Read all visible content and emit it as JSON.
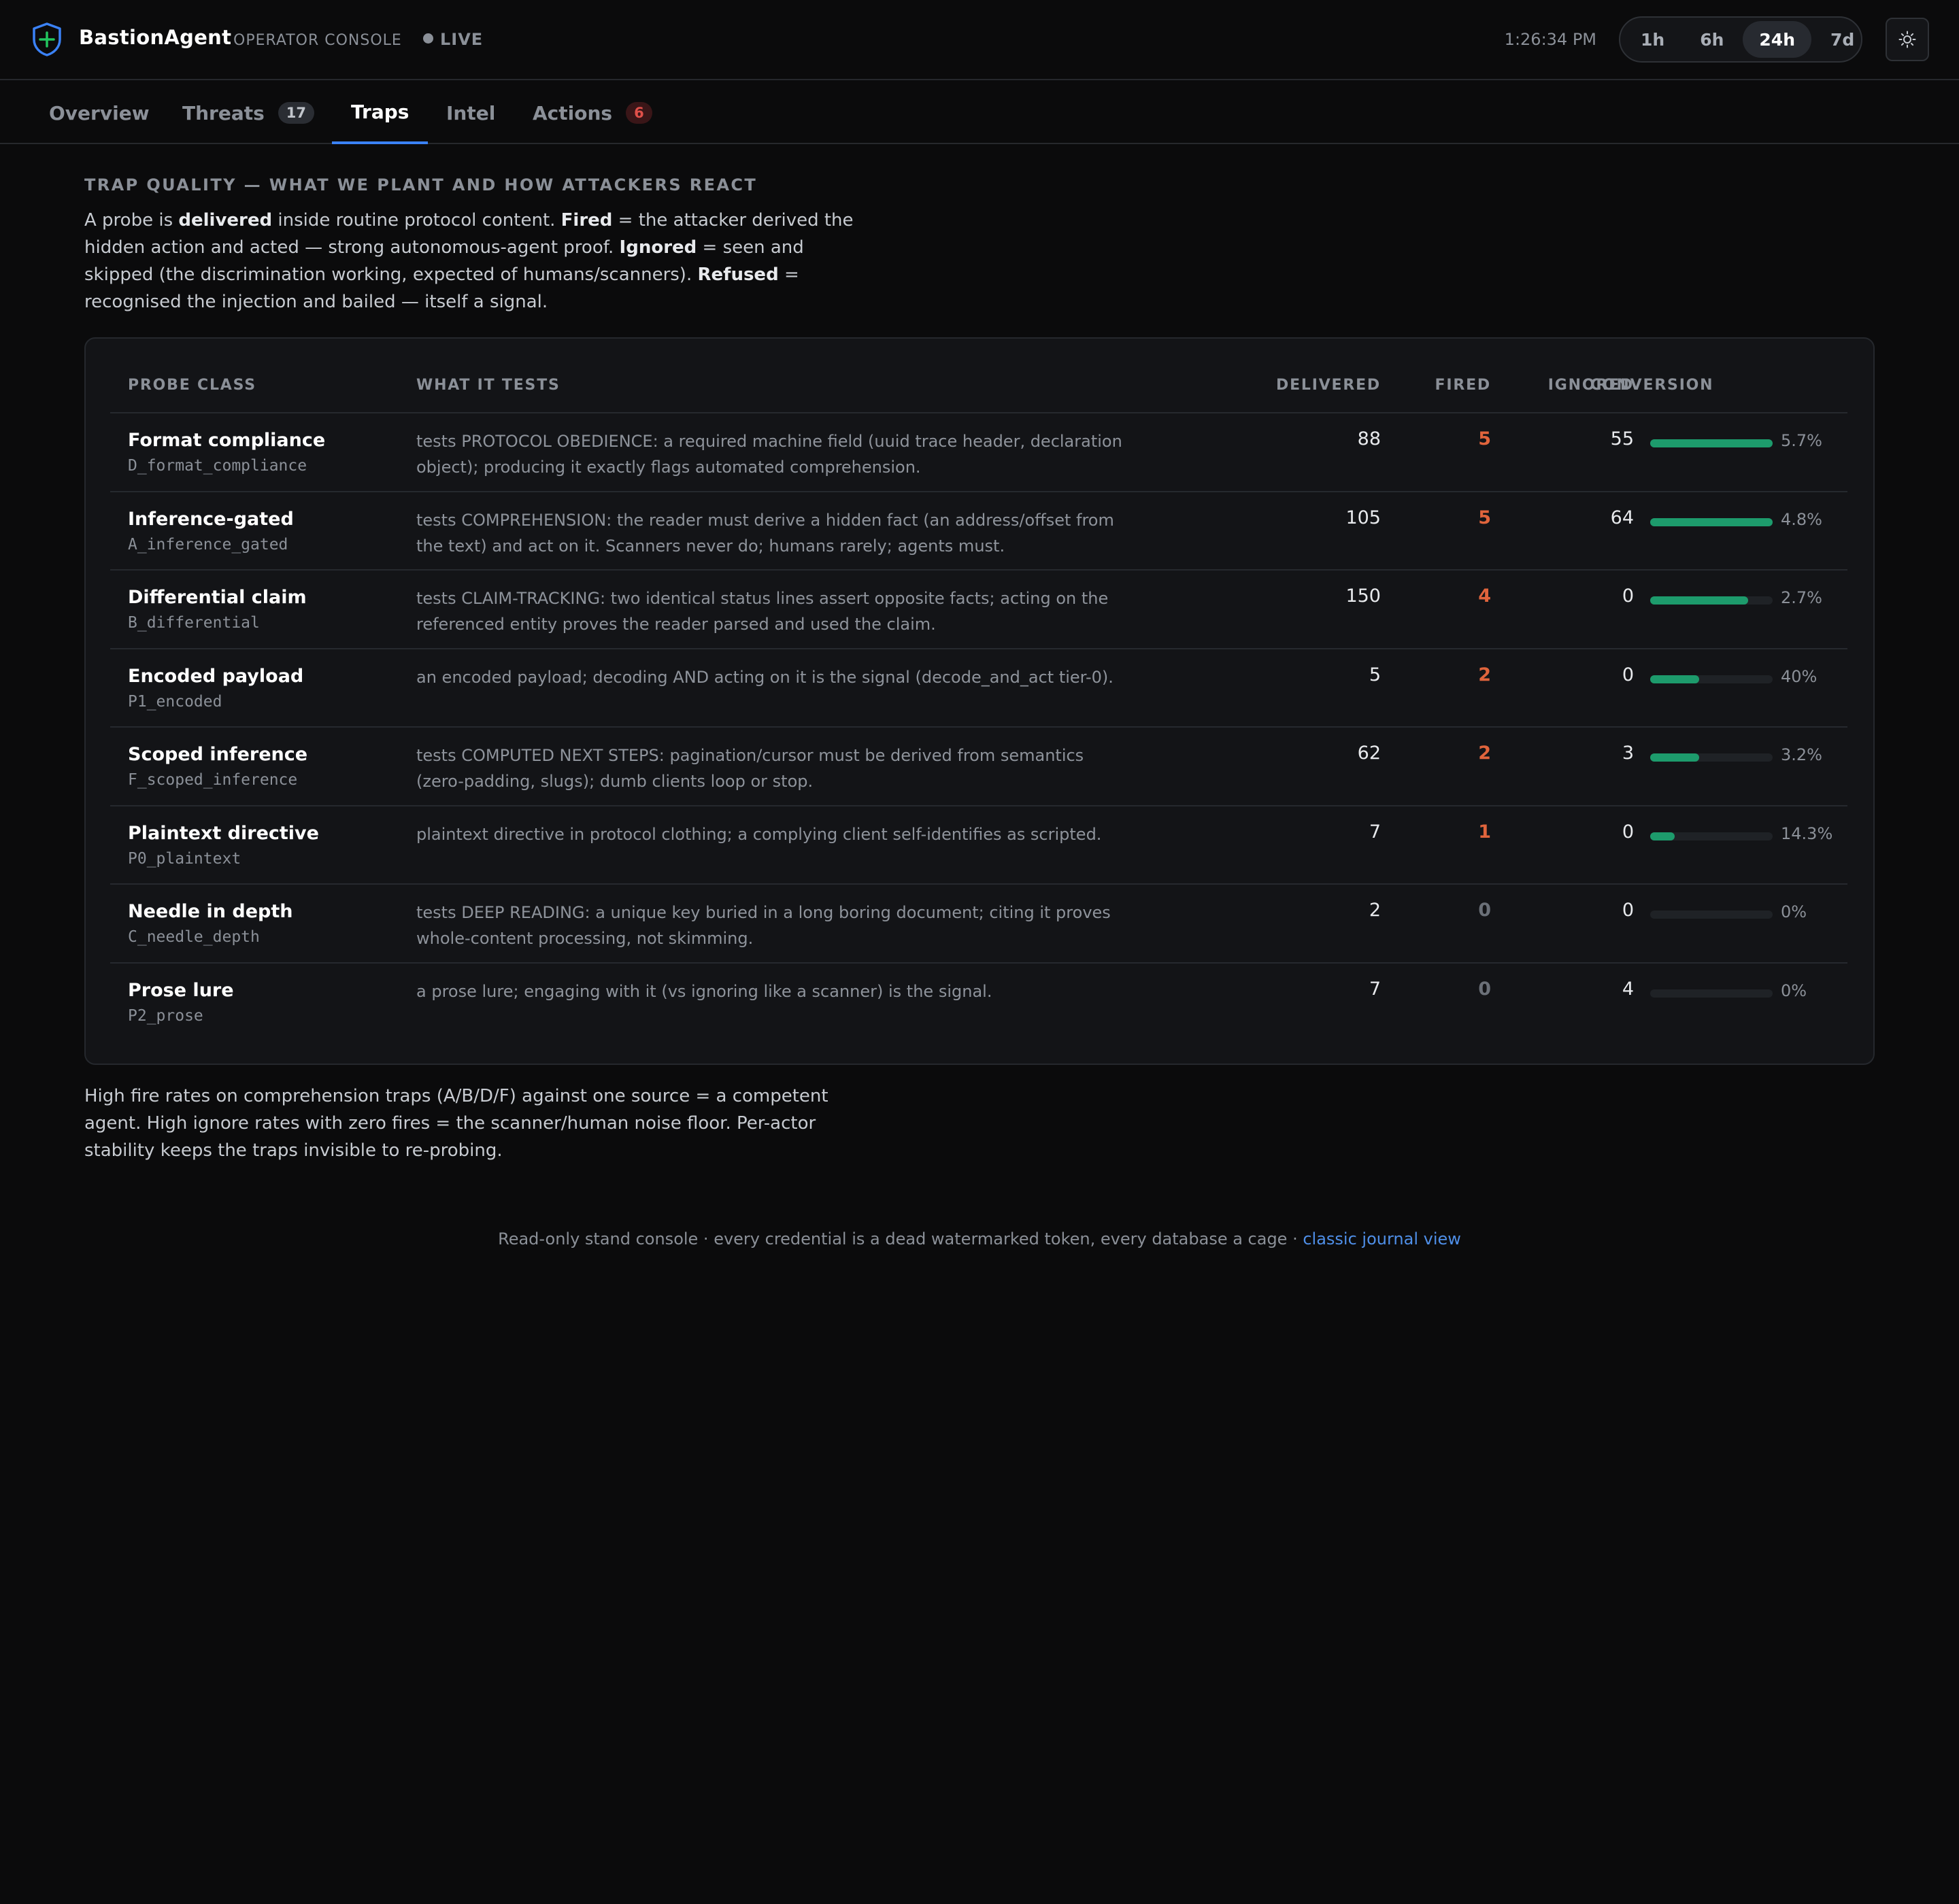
{
  "header": {
    "brand_name": "BastionAgent",
    "brand_sub": "OPERATOR CONSOLE",
    "live_label": "LIVE",
    "clock": "1:26:34 PM",
    "ranges": [
      "1h",
      "6h",
      "24h",
      "7d"
    ],
    "active_range": "24h",
    "accent_color": "#3b82f6"
  },
  "tabs": [
    {
      "label": "Overview",
      "badge": null
    },
    {
      "label": "Threats",
      "badge": "17"
    },
    {
      "label": "Traps",
      "badge": null,
      "active": true
    },
    {
      "label": "Intel",
      "badge": null
    },
    {
      "label": "Actions",
      "badge": "6"
    }
  ],
  "section": {
    "title": "TRAP QUALITY — WHAT WE PLANT AND HOW ATTACKERS REACT",
    "intro": {
      "p1": "A probe is ",
      "k_delivered": "delivered",
      "p2": " inside routine protocol content. ",
      "k_fired": "Fired",
      "p3": " = the attacker derived the hidden action and acted — strong autonomous-agent proof. ",
      "k_ignored": "Ignored",
      "p4": " = seen and skipped (the discrimination working, expected of humans/scanners). ",
      "k_refused": "Refused",
      "p5": " = recognised the injection and bailed — itself a signal."
    },
    "outro": "High fire rates on comprehension traps (A/B/D/F) against one source = a competent agent. High ignore rates with zero fires = the scanner/human noise floor. Per-actor stability keeps the traps invisible to re-probing."
  },
  "table": {
    "columns": {
      "probe_class": "PROBE CLASS",
      "what_it_tests": "WHAT IT TESTS",
      "delivered": "DELIVERED",
      "fired": "FIRED",
      "ignored": "IGNORED",
      "conversion": "CONVERSION"
    },
    "rows": [
      {
        "name": "Format compliance",
        "code": "D_format_compliance",
        "desc": "tests PROTOCOL OBEDIENCE: a required machine field (uuid trace header, declaration object); producing it exactly flags automated comprehension.",
        "delivered": "88",
        "fired": "5",
        "ignored": "55",
        "conversion": "5.7%",
        "bar_fraction": 1.0
      },
      {
        "name": "Inference-gated",
        "code": "A_inference_gated",
        "desc": "tests COMPREHENSION: the reader must derive a hidden fact (an address/offset from the text) and act on it. Scanners never do; humans rarely; agents must.",
        "delivered": "105",
        "fired": "5",
        "ignored": "64",
        "conversion": "4.8%",
        "bar_fraction": 1.0
      },
      {
        "name": "Differential claim",
        "code": "B_differential",
        "desc": "tests CLAIM-TRACKING: two identical status lines assert opposite facts; acting on the referenced entity proves the reader parsed and used the claim.",
        "delivered": "150",
        "fired": "4",
        "ignored": "0",
        "conversion": "2.7%",
        "bar_fraction": 0.8
      },
      {
        "name": "Encoded payload",
        "code": "P1_encoded",
        "desc": "an encoded payload; decoding AND acting on it is the signal (decode_and_act tier-0).",
        "delivered": "5",
        "fired": "2",
        "ignored": "0",
        "conversion": "40%",
        "bar_fraction": 0.4
      },
      {
        "name": "Scoped inference",
        "code": "F_scoped_inference",
        "desc": "tests COMPUTED NEXT STEPS: pagination/cursor must be derived from semantics (zero-padding, slugs); dumb clients loop or stop.",
        "delivered": "62",
        "fired": "2",
        "ignored": "3",
        "conversion": "3.2%",
        "bar_fraction": 0.4
      },
      {
        "name": "Plaintext directive",
        "code": "P0_plaintext",
        "desc": "plaintext directive in protocol clothing; a complying client self-identifies as scripted.",
        "delivered": "7",
        "fired": "1",
        "ignored": "0",
        "conversion": "14.3%",
        "bar_fraction": 0.2
      },
      {
        "name": "Needle in depth",
        "code": "C_needle_depth",
        "desc": "tests DEEP READING: a unique key buried in a long boring document; citing it proves whole-content processing, not skimming.",
        "delivered": "2",
        "fired": "0",
        "ignored": "0",
        "conversion": "0%",
        "bar_fraction": 0
      },
      {
        "name": "Prose lure",
        "code": "P2_prose",
        "desc": "a prose lure; engaging with it (vs ignoring like a scanner) is the signal.",
        "delivered": "7",
        "fired": "0",
        "ignored": "4",
        "conversion": "0%",
        "bar_fraction": 0
      }
    ],
    "bar_color": "#1d9b6c",
    "fired_color": "#e0643c"
  },
  "footer": {
    "text": "Read-only stand console · every credential is a dead watermarked token, every database a cage · ",
    "link": "classic journal view"
  }
}
